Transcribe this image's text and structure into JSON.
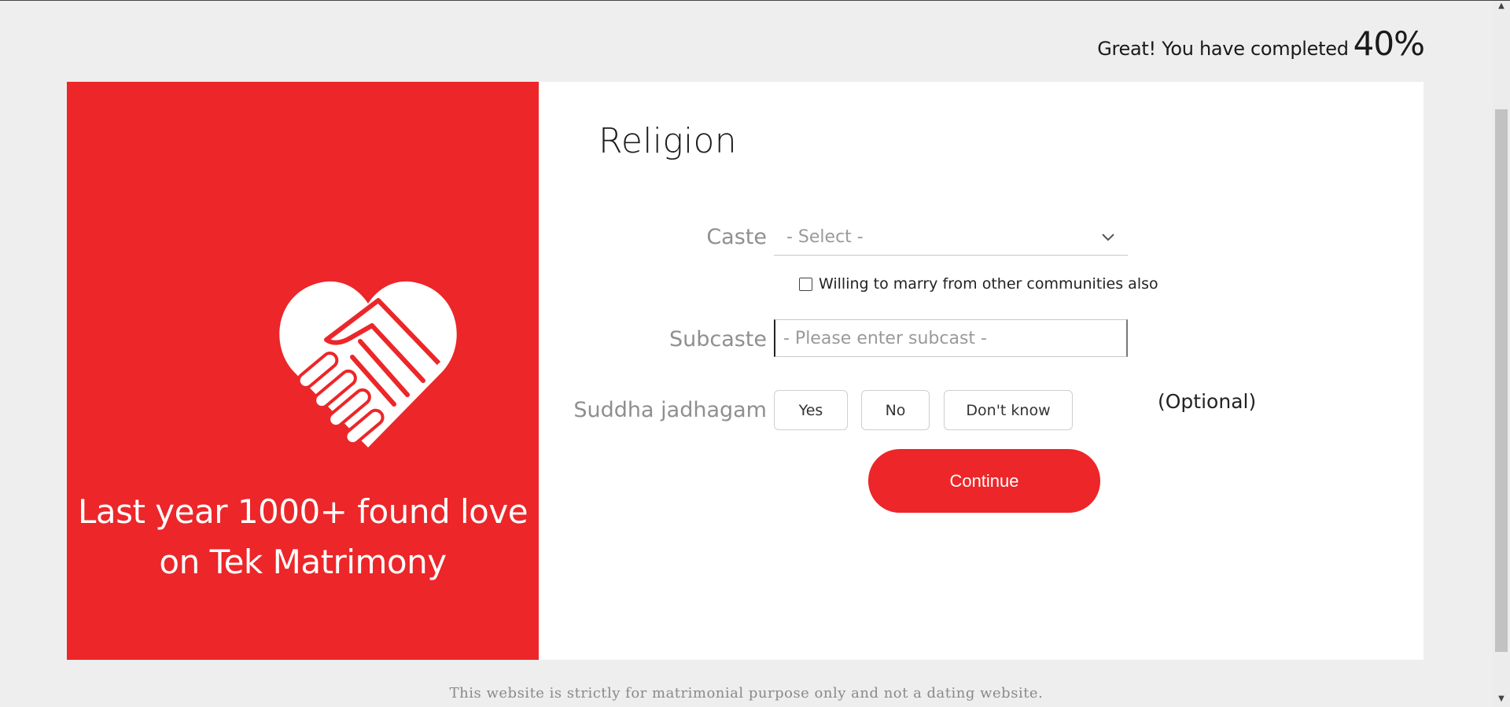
{
  "progress": {
    "message": "Great! You have completed",
    "percent": "40%"
  },
  "left_panel": {
    "icon": "heart-handshake-icon",
    "tagline_line1": "Last year 1000+ found love",
    "tagline_line2": "on Tek Matrimony"
  },
  "form": {
    "title": "Religion",
    "caste": {
      "label": "Caste",
      "selected": "- Select -"
    },
    "other_communities_label": "Willing to marry from other communities also",
    "subcaste": {
      "label": "Subcaste",
      "placeholder": "- Please enter subcast -"
    },
    "jadhagam": {
      "label": "Suddha jadhagam",
      "options": [
        "Yes",
        "No",
        "Don't know"
      ],
      "optional_note": "(Optional)"
    },
    "continue_label": "Continue"
  },
  "footer": {
    "text": "This website is strictly for matrimonial purpose only and not a dating website."
  },
  "colors": {
    "brand_red": "#ec2629",
    "background": "#eeeeee"
  }
}
